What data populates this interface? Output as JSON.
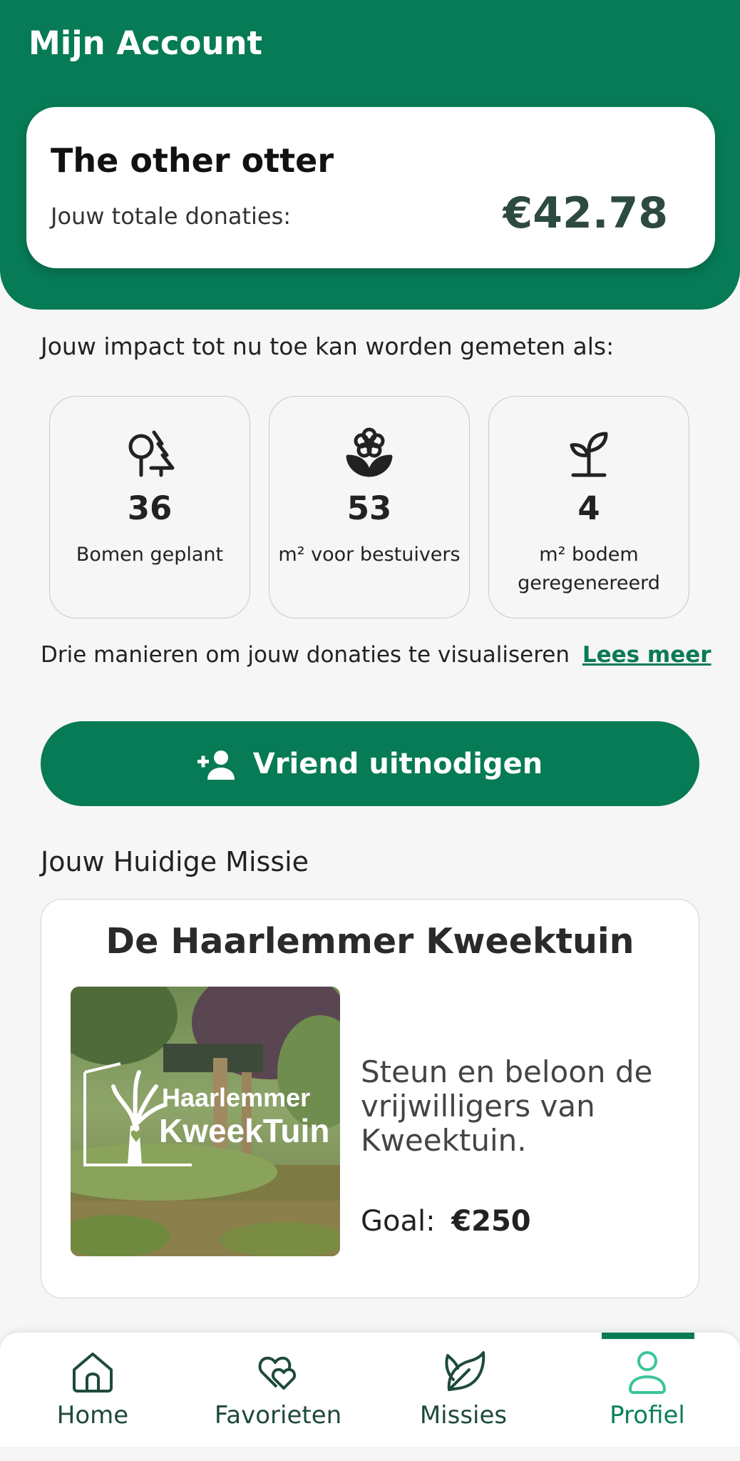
{
  "header": {
    "title": "Mijn Account",
    "user_name": "The other otter",
    "donations_label": "Jouw totale donaties:",
    "donations_total": "€42.78"
  },
  "impact": {
    "heading": "Jouw impact tot nu toe kan worden gemeten als:",
    "cards": [
      {
        "icon": "trees-icon",
        "value": "36",
        "label": "Bomen geplant"
      },
      {
        "icon": "flower-icon",
        "value": "53",
        "label": "m² voor bestuivers"
      },
      {
        "icon": "sprout-icon",
        "value": "4",
        "label": "m² bodem geregenereerd"
      }
    ],
    "visualise_text": "Drie manieren om jouw donaties te visualiseren",
    "visualise_link": "Lees meer"
  },
  "invite": {
    "label": "Vriend uitnodigen",
    "icon": "add-person-icon"
  },
  "mission": {
    "heading": "Jouw Huidige Missie",
    "title": "De Haarlemmer Kweektuin",
    "image_logo_line1": "Haarlemmer",
    "image_logo_line2": "KweekTuin",
    "description": "Steun en beloon de vrijwilligers van Kweektuin.",
    "goal_label": "Goal:",
    "goal_amount": "€250"
  },
  "nav": {
    "items": [
      {
        "label": "Home",
        "icon": "home-icon"
      },
      {
        "label": "Favorieten",
        "icon": "hearts-icon"
      },
      {
        "label": "Missies",
        "icon": "leaf-icon"
      },
      {
        "label": "Profiel",
        "icon": "person-icon"
      }
    ],
    "active_index": 3
  },
  "colors": {
    "brand_green": "#077a56",
    "amount_text": "#2d4a3e",
    "background": "#f6f6f6"
  }
}
